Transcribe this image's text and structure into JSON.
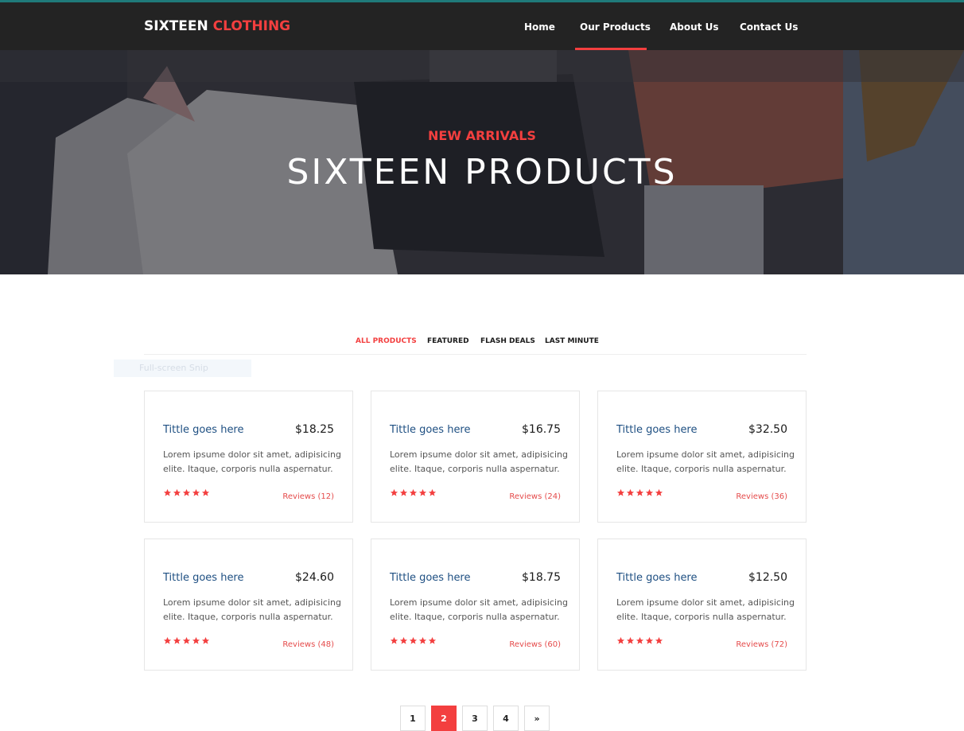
{
  "brand": {
    "part1": "SIXTEEN",
    "part2": "CLOTHING"
  },
  "nav": {
    "items": [
      "Home",
      "Our Products",
      "About Us",
      "Contact Us"
    ],
    "active": "Our Products"
  },
  "hero": {
    "kicker": "NEW ARRIVALS",
    "title": "SIXTEEN PRODUCTS"
  },
  "filters": {
    "items": [
      "ALL PRODUCTS",
      "FEATURED",
      "FLASH DEALS",
      "LAST MINUTE"
    ],
    "active": "ALL PRODUCTS"
  },
  "overlay_snip": {
    "label": "Full-screen Snip"
  },
  "products": [
    {
      "title": "Tittle goes here",
      "price": "$18.25",
      "desc": "Lorem ipsume dolor sit amet, adipisicing elite. Itaque, corporis nulla aspernatur.",
      "rating": 5,
      "reviews": "Reviews (12)"
    },
    {
      "title": "Tittle goes here",
      "price": "$16.75",
      "desc": "Lorem ipsume dolor sit amet, adipisicing elite. Itaque, corporis nulla aspernatur.",
      "rating": 5,
      "reviews": "Reviews (24)"
    },
    {
      "title": "Tittle goes here",
      "price": "$32.50",
      "desc": "Lorem ipsume dolor sit amet, adipisicing elite. Itaque, corporis nulla aspernatur.",
      "rating": 5,
      "reviews": "Reviews (36)"
    },
    {
      "title": "Tittle goes here",
      "price": "$24.60",
      "desc": "Lorem ipsume dolor sit amet, adipisicing elite. Itaque, corporis nulla aspernatur.",
      "rating": 5,
      "reviews": "Reviews (48)"
    },
    {
      "title": "Tittle goes here",
      "price": "$18.75",
      "desc": "Lorem ipsume dolor sit amet, adipisicing elite. Itaque, corporis nulla aspernatur.",
      "rating": 5,
      "reviews": "Reviews (60)"
    },
    {
      "title": "Tittle goes here",
      "price": "$12.50",
      "desc": "Lorem ipsume dolor sit amet, adipisicing elite. Itaque, corporis nulla aspernatur.",
      "rating": 5,
      "reviews": "Reviews (72)"
    }
  ],
  "pagination": {
    "pages": [
      "1",
      "2",
      "3",
      "4"
    ],
    "active": "2",
    "next": "»"
  },
  "colors": {
    "accent": "#f33f3f",
    "navbar": "#232323",
    "title_blue": "#1e4f82"
  },
  "icons": {
    "star": "star-icon"
  }
}
